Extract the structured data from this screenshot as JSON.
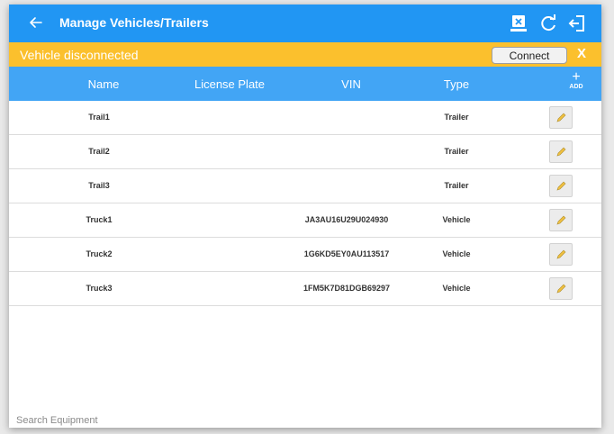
{
  "appbar": {
    "title": "Manage Vehicles/Trailers"
  },
  "banner": {
    "status": "Vehicle disconnected",
    "connect_label": "Connect",
    "close_label": "X"
  },
  "table": {
    "columns": [
      "Name",
      "License Plate",
      "VIN",
      "Type"
    ],
    "add_label": "ADD",
    "rows": [
      {
        "name": "Trail1",
        "plate": "",
        "vin": "",
        "type": "Trailer"
      },
      {
        "name": "Trail2",
        "plate": "",
        "vin": "",
        "type": "Trailer"
      },
      {
        "name": "Trail3",
        "plate": "",
        "vin": "",
        "type": "Trailer"
      },
      {
        "name": "Truck1",
        "plate": "",
        "vin": "JA3AU16U29U024930",
        "type": "Vehicle"
      },
      {
        "name": "Truck2",
        "plate": "",
        "vin": "1G6KD5EY0AU113517",
        "type": "Vehicle"
      },
      {
        "name": "Truck3",
        "plate": "",
        "vin": "1FM5K7D81DGB69297",
        "type": "Vehicle"
      }
    ]
  },
  "search": {
    "placeholder": "Search Equipment"
  },
  "colors": {
    "appbar": "#2196f3",
    "banner": "#fbc02d",
    "header": "#42a5f5"
  },
  "icons": {
    "back": "arrow-left-icon",
    "disconnect_device": "device-disconnect-icon",
    "refresh": "refresh-icon",
    "logout": "logout-icon",
    "edit": "pencil-icon"
  }
}
